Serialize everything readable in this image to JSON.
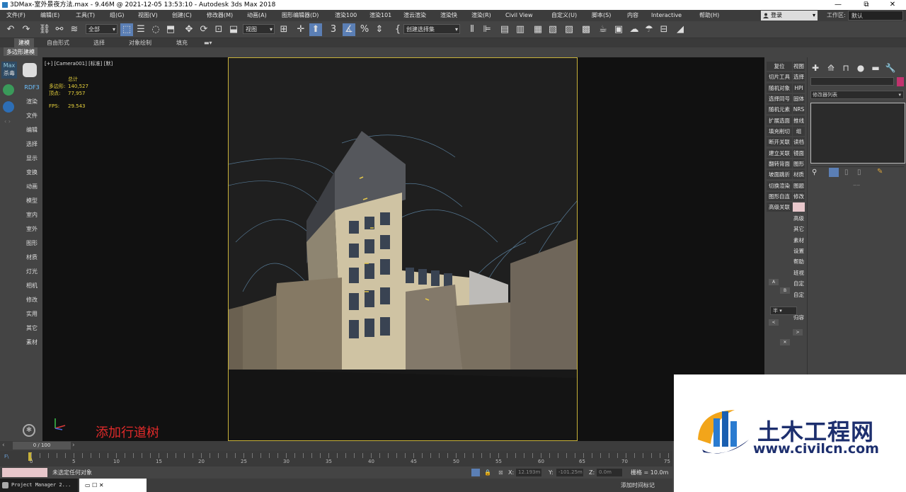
{
  "window": {
    "title": "3DMax-室外景夜方法.max - 9.46M @ 2021-12-05 13:53:10 - Autodesk 3ds Max 2018",
    "min": "—",
    "max": "⧉",
    "close": "✕"
  },
  "menubar": {
    "items": [
      "文件(F)",
      "编辑(E)",
      "工具(T)",
      "组(G)",
      "视图(V)",
      "创建(C)",
      "修改器(M)",
      "动画(A)",
      "图形编辑器(D)",
      "渲染100",
      "渲染101",
      "渲云渲染",
      "渲染快",
      "渲染(R)",
      "Civil View",
      "自定义(U)",
      "脚本(S)",
      "内容",
      "Interactive",
      "帮助(H)"
    ],
    "login": "登录",
    "workspace_label": "工作区:",
    "workspace_value": "默认"
  },
  "toolbar": {
    "filter_select": "全部",
    "refcoord_select": "视图",
    "selection_set": "创建选择集"
  },
  "ribbon": {
    "tabs": [
      "建模",
      "自由形式",
      "选择",
      "对象绘制",
      "填充"
    ],
    "subtab": "多边形建模"
  },
  "leftbar": {
    "logo_line1": "Max",
    "logo_line2": "杀毒",
    "rdf": "RDF3",
    "items": [
      "渲染",
      "文件",
      "编辑",
      "选择",
      "显示",
      "变换",
      "动画",
      "模型",
      "室内",
      "室外",
      "图形",
      "材质",
      "灯光",
      "相机",
      "修改",
      "实用",
      "其它",
      "素材"
    ]
  },
  "viewport": {
    "label": "[+] [Camera001] [标准] [默]",
    "stats": {
      "total_label": "总计",
      "poly_label": "多边形:",
      "poly_value": "140,527",
      "vert_label": "顶点:",
      "vert_value": "77,957",
      "fps_label": "FPS:",
      "fps_value": "29.543"
    },
    "caption": "添加行道树"
  },
  "rcol": {
    "left_buttons": [
      "复位",
      "切片工具",
      "随机对象",
      "选择同号",
      "随机元素",
      "扩展选面",
      "填充削切",
      "断开关联",
      "建立关联",
      "翻转背面",
      "坡面跳折",
      "切换渲染",
      "图形自连",
      "高级关联"
    ],
    "right_buttons": [
      "视图",
      "选择",
      "HPI",
      "固体",
      "NRS",
      "推线",
      "组",
      "读档",
      "镜面",
      "图形",
      "材质",
      "图题",
      "修改"
    ],
    "lower_right": [
      "高级",
      "其它",
      "素材",
      "设置",
      "帮助",
      "班视",
      "自定",
      "自定",
      "归容"
    ]
  },
  "cmdpanel": {
    "modifier_list": "修改器列表"
  },
  "timeline": {
    "frame": "0 / 100",
    "ticks": [
      "0",
      "5",
      "10",
      "15",
      "20",
      "25",
      "30",
      "35",
      "40",
      "45",
      "50",
      "55",
      "60",
      "65",
      "70",
      "75"
    ]
  },
  "status": {
    "message": "未选定任何对象",
    "x_label": "X:",
    "x_value": "12.193m",
    "y_label": "Y:",
    "y_value": "-101.25m",
    "z_label": "Z:",
    "z_value": "0.0m",
    "grid_label": "栅格 = 10.0m",
    "time_tag": "添加时间标记"
  },
  "taskbar": {
    "task1": "Project Manager 2...",
    "task2_icons": "▭  ☐  ✕"
  },
  "watermark": {
    "title": "土木工程网",
    "url": "www.civilcn.com"
  },
  "colors": {
    "accent": "#5b7fb5",
    "frame": "#c8b23a",
    "caption": "#e02a2a",
    "brand": "#1d2f6e"
  }
}
